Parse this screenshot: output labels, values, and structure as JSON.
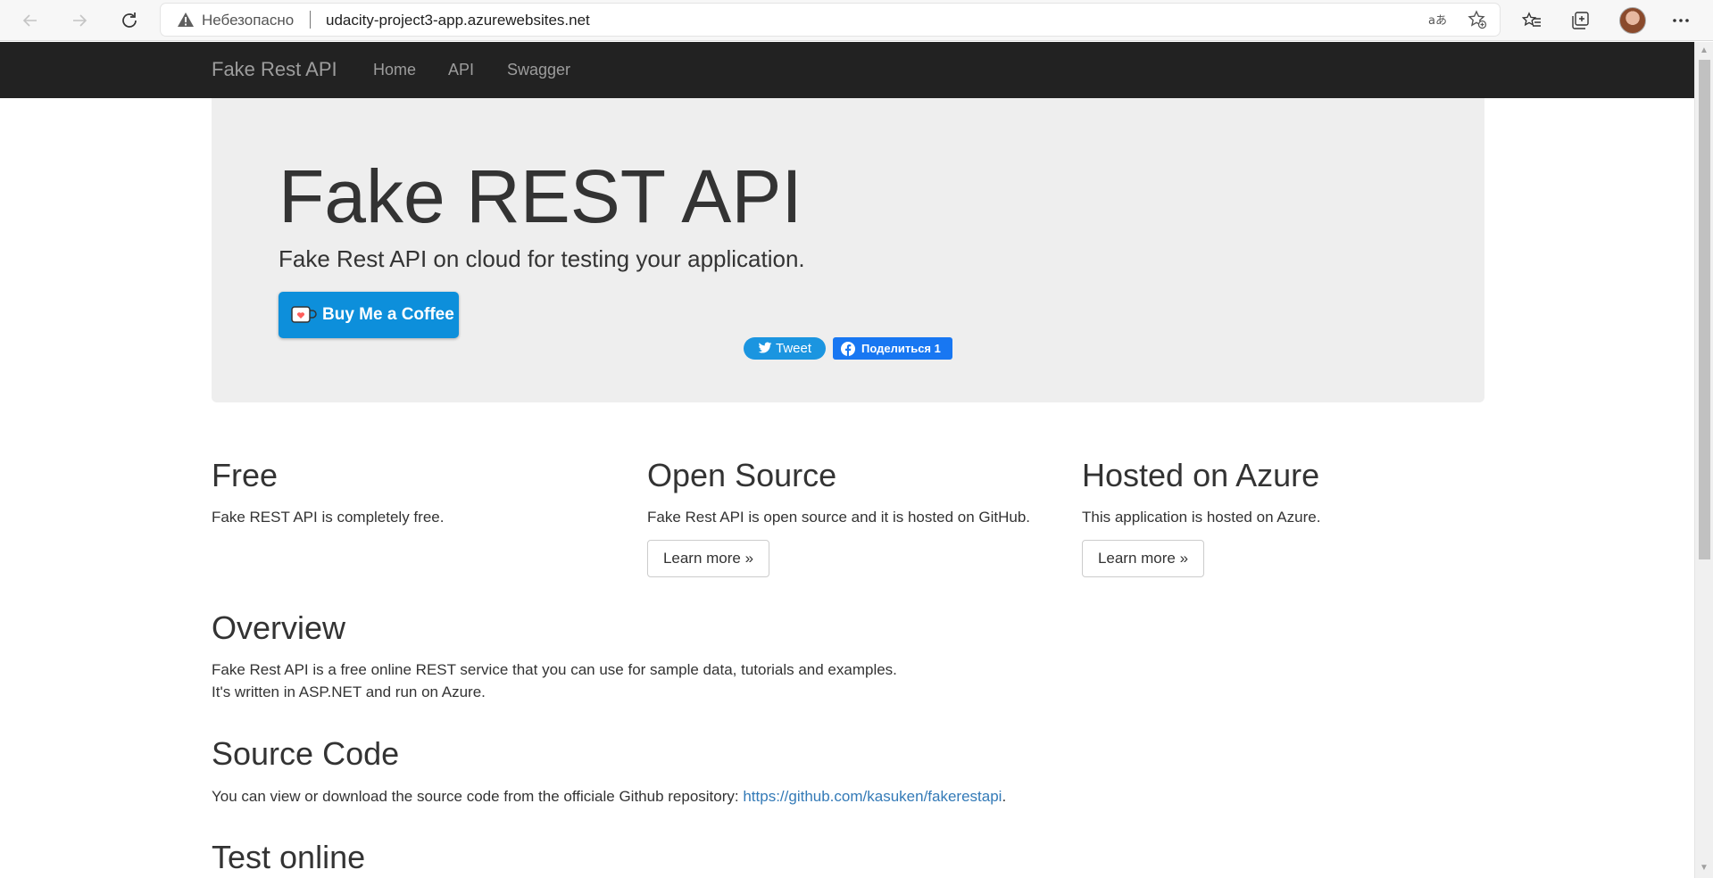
{
  "browser": {
    "security_label": "Небезопасно",
    "url": "udacity-project3-app.azurewebsites.net"
  },
  "navbar": {
    "brand": "Fake Rest API",
    "links": [
      "Home",
      "API",
      "Swagger"
    ]
  },
  "jumbotron": {
    "title": "Fake REST API",
    "lead": "Fake Rest API on cloud for testing your application.",
    "coffee_button": "Buy Me a Coffee",
    "tweet_button": "Tweet",
    "fb_button": "Поделиться 1"
  },
  "features": [
    {
      "title": "Free",
      "text": "Fake REST API is completely free."
    },
    {
      "title": "Open Source",
      "text": "Fake Rest API is open source and it is hosted on GitHub.",
      "button": "Learn more »"
    },
    {
      "title": "Hosted on Azure",
      "text": "This application is hosted on Azure.",
      "button": "Learn more »"
    }
  ],
  "overview": {
    "title": "Overview",
    "line1": "Fake Rest API is a free online REST service that you can use for sample data, tutorials and examples.",
    "line2": "It's written in ASP.NET and run on Azure."
  },
  "source_code": {
    "title": "Source Code",
    "text": "You can view or download the source code from the officiale Github repository: ",
    "link": "https://github.com/kasuken/fakerestapi",
    "trailing": "."
  },
  "test_online": {
    "title": "Test online"
  },
  "colors": {
    "navbar_bg": "#222222",
    "jumbotron_bg": "#eeeeee",
    "coffee_btn": "#0d8fdb",
    "tweet_btn": "#1b95e0",
    "fb_btn": "#1877f2",
    "link": "#337ab7"
  }
}
